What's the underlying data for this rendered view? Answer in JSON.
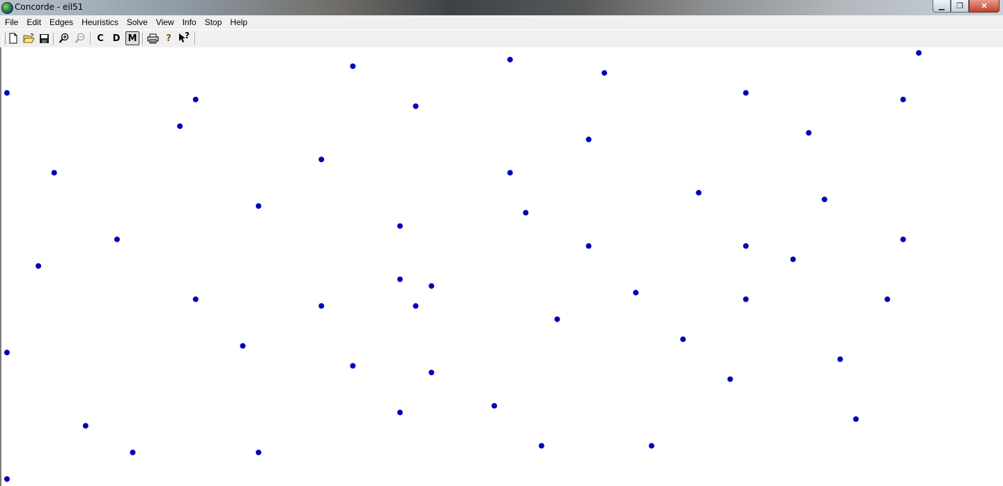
{
  "window": {
    "title": "Concorde - eil51",
    "minimize_label": "▁",
    "maximize_label": "❐",
    "close_label": "✕"
  },
  "menu": [
    "File",
    "Edit",
    "Edges",
    "Heuristics",
    "Solve",
    "View",
    "Info",
    "Stop",
    "Help"
  ],
  "toolbar": {
    "c_label": "C",
    "d_label": "D",
    "m_label": "M",
    "help_label": "?",
    "context_help_label": "?"
  },
  "colors": {
    "node": "#0000b8",
    "background": "#ffffff"
  },
  "chart_data": {
    "type": "scatter",
    "title": "",
    "xlabel": "",
    "ylabel": "",
    "grid": false,
    "xlim": [
      0,
      63
    ],
    "ylim": [
      5,
      69
    ],
    "series": [
      {
        "points": [
          [
            0,
            63
          ],
          [
            0,
            24
          ],
          [
            0,
            5
          ],
          [
            3,
            51
          ],
          [
            2,
            37
          ],
          [
            5,
            13
          ],
          [
            8,
            9
          ],
          [
            7,
            41
          ],
          [
            11,
            58
          ],
          [
            12,
            62
          ],
          [
            12,
            32
          ],
          [
            15,
            25
          ],
          [
            16,
            46
          ],
          [
            16,
            9
          ],
          [
            20,
            53
          ],
          [
            20,
            31
          ],
          [
            22,
            67
          ],
          [
            22,
            22
          ],
          [
            25,
            43
          ],
          [
            25,
            35
          ],
          [
            25,
            15
          ],
          [
            26,
            61
          ],
          [
            26,
            31
          ],
          [
            27,
            34
          ],
          [
            27,
            21
          ],
          [
            31,
            16
          ],
          [
            32,
            68
          ],
          [
            32,
            51
          ],
          [
            33,
            45
          ],
          [
            34,
            10
          ],
          [
            35,
            29
          ],
          [
            38,
            66
          ],
          [
            37,
            56
          ],
          [
            37,
            40
          ],
          [
            40,
            33
          ],
          [
            41,
            10
          ],
          [
            43,
            26
          ],
          [
            44,
            48
          ],
          [
            46,
            20
          ],
          [
            47,
            63
          ],
          [
            47,
            40
          ],
          [
            47,
            32
          ],
          [
            51,
            57
          ],
          [
            50,
            38
          ],
          [
            52,
            47
          ],
          [
            53,
            23
          ],
          [
            54,
            14
          ],
          [
            57,
            62
          ],
          [
            57,
            41
          ],
          [
            56,
            32
          ],
          [
            58,
            69
          ]
        ]
      }
    ]
  }
}
